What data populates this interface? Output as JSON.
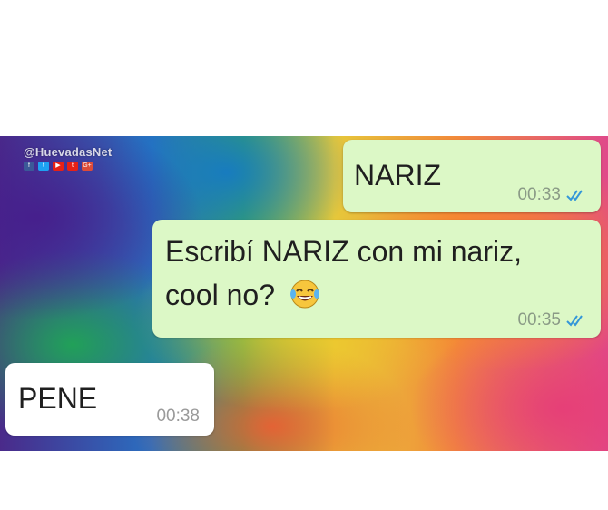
{
  "watermark": {
    "handle": "@HuevadasNet",
    "icons": [
      {
        "name": "facebook-icon",
        "glyph": "f",
        "color": "#3b5998"
      },
      {
        "name": "twitter-icon",
        "glyph": "t",
        "color": "#1da1f2"
      },
      {
        "name": "youtube-icon",
        "glyph": "▶",
        "color": "#e62117"
      },
      {
        "name": "tumblr-icon",
        "glyph": "t",
        "color": "#e62117"
      },
      {
        "name": "googleplus-icon",
        "glyph": "G+",
        "color": "#dd4b39"
      }
    ]
  },
  "messages": [
    {
      "direction": "outgoing",
      "text": "NARIZ",
      "time": "00:33",
      "status": "read"
    },
    {
      "direction": "outgoing",
      "text_line1": "Escribí NARIZ con mi nariz,",
      "text_line2": "cool no?",
      "emoji": "face-with-tears-of-joy",
      "time": "00:35",
      "status": "read"
    },
    {
      "direction": "incoming",
      "text": "PENE",
      "time": "00:38"
    }
  ],
  "colors": {
    "outgoing_bubble": "#dcf8c6",
    "incoming_bubble": "#ffffff",
    "read_ticks": "#3497d8"
  }
}
